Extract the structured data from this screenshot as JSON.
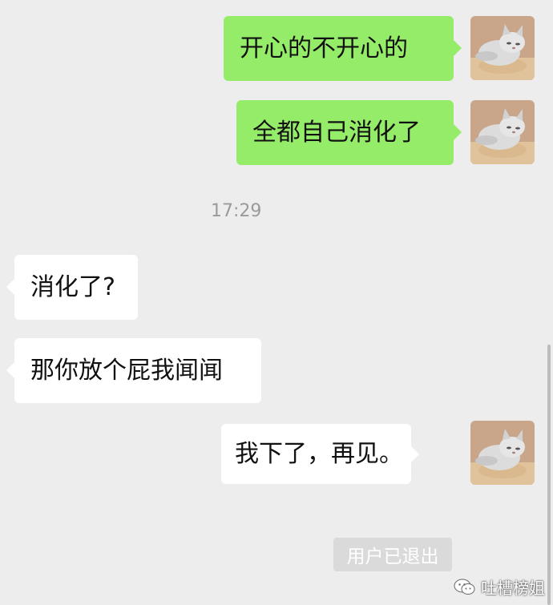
{
  "messages": [
    {
      "side": "right",
      "text": "开心的不开心的"
    },
    {
      "side": "right",
      "text": "全都自己消化了"
    },
    {
      "side": "left",
      "text": "消化了?"
    },
    {
      "side": "left",
      "text": "那你放个屁我闻闻"
    },
    {
      "side": "right",
      "text": "我下了，再见。"
    }
  ],
  "timestamp": "17:29",
  "system_notice": "用户已退出",
  "watermark": "吐槽榜姐",
  "avatar_icon": "cat-avatar",
  "colors": {
    "background": "#ededed",
    "sent_bubble": "#95ec69",
    "received_bubble": "#ffffff",
    "timestamp_text": "#9a9a9a",
    "system_notice_bg": "#dadada"
  }
}
